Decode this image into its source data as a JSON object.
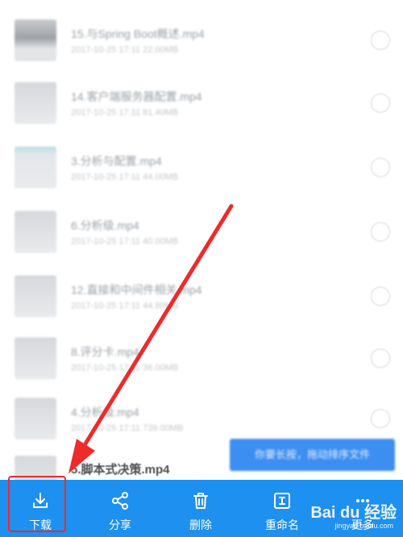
{
  "file_list": {
    "rows": [
      {
        "name": "15.与Spring Boot概述.mp4",
        "meta": "2017-10-25  17:11  22.00MB"
      },
      {
        "name": "14.客户端服务器配置.mp4",
        "meta": "2017-10-25  17:11  81.40MB"
      },
      {
        "name": "3.分析与配置.mp4",
        "meta": "2017-10-25  17:11  44.00MB"
      },
      {
        "name": "6.分析级.mp4",
        "meta": "2017-10-25  17:11  40.00MB"
      },
      {
        "name": "12.直接和中间件相关.mp4",
        "meta": "2017-10-25  17:11  44.80MB"
      },
      {
        "name": "8.评分卡.mp4",
        "meta": "2017-10-25  17:11  36.00MB"
      },
      {
        "name": "4.分析级.mp4",
        "meta": "2017-10-25  17:11  739.00MB"
      },
      {
        "name": "5.脚本式决策.mp4",
        "meta": ""
      }
    ]
  },
  "toast": {
    "text": "你要长按，拖动排序文件"
  },
  "toolbar": {
    "download": "下载",
    "share": "分享",
    "delete": "删除",
    "rename": "重命名",
    "more": "更多"
  },
  "watermark": {
    "brand": "Bai du 经验",
    "url": "jingyan.baidu.com"
  },
  "colors": {
    "toolbar": "#1e90f0",
    "highlight": "#ee2a2a",
    "toast": "#3c8ef0"
  }
}
